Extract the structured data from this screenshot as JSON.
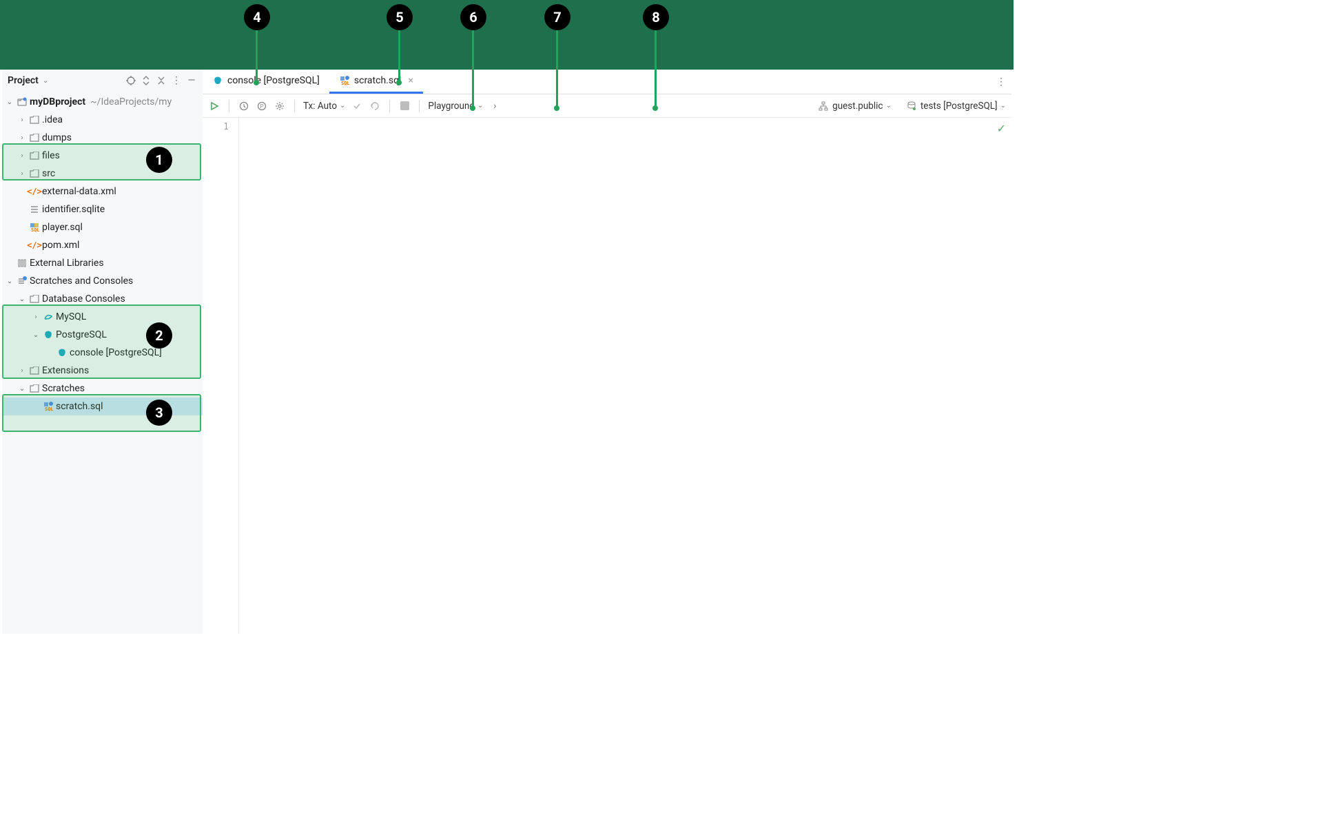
{
  "sidebar": {
    "title": "Project",
    "tree": {
      "root": {
        "name": "myDBproject",
        "path": "~/IdeaProjects/my"
      },
      "items": {
        "idea": ".idea",
        "dumps": "dumps",
        "files": "files",
        "src": "src",
        "external_xml": "external-data.xml",
        "identifier": "identifier.sqlite",
        "player_sql": "player.sql",
        "pom": "pom.xml",
        "ext_libs": "External Libraries",
        "scratch_root": "Scratches and Consoles",
        "db_consoles": "Database Consoles",
        "mysql": "MySQL",
        "postgres": "PostgreSQL",
        "console_pg": "console [PostgreSQL]",
        "extensions": "Extensions",
        "scratches": "Scratches",
        "scratch_sql": "scratch.sql"
      }
    }
  },
  "tabs": {
    "console": "console [PostgreSQL]",
    "scratch": "scratch.sql"
  },
  "toolbar": {
    "tx": "Tx: Auto",
    "playground": "Playground",
    "schema": "guest.public",
    "datasource": "tests [PostgreSQL]"
  },
  "editor": {
    "line_number": "1"
  },
  "callouts": {
    "c1": "1",
    "c2": "2",
    "c3": "3",
    "c4": "4",
    "c5": "5",
    "c6": "6",
    "c7": "7",
    "c8": "8"
  }
}
